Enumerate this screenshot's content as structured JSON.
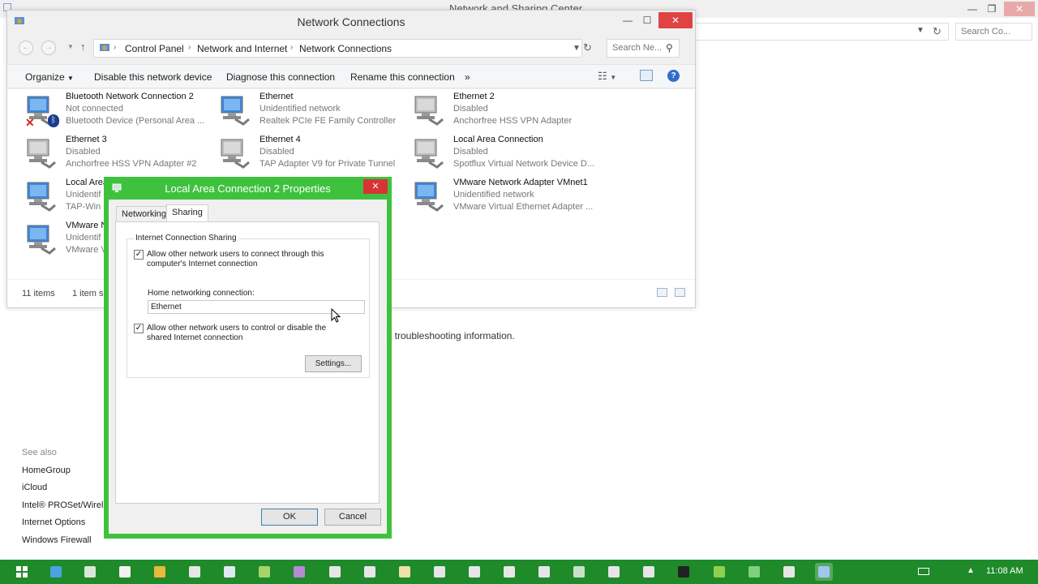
{
  "background_window": {
    "title": "Network and Sharing Center",
    "search_placeholder": "Search Co...",
    "info_text": "t troubleshooting information.",
    "see_also": {
      "heading": "See also",
      "links": [
        "HomeGroup",
        "iCloud",
        "Intel® PROSet/Wirel",
        "Internet Options",
        "Windows Firewall"
      ]
    }
  },
  "nc_window": {
    "title": "Network Connections",
    "breadcrumbs": [
      "Control Panel",
      "Network and Internet",
      "Network Connections"
    ],
    "search_placeholder": "Search Ne...",
    "toolbar": {
      "organize": "Organize",
      "disable": "Disable this network device",
      "diagnose": "Diagnose this connection",
      "rename": "Rename this connection",
      "more": "»"
    },
    "connections": [
      {
        "name": "Bluetooth Network Connection 2",
        "status": "Not connected",
        "device": "Bluetooth Device (Personal Area ..."
      },
      {
        "name": "Ethernet",
        "status": "Unidentified network",
        "device": "Realtek PCIe FE Family Controller"
      },
      {
        "name": "Ethernet 2",
        "status": "Disabled",
        "device": "Anchorfree HSS VPN Adapter"
      },
      {
        "name": "Ethernet 3",
        "status": "Disabled",
        "device": "Anchorfree HSS VPN Adapter #2"
      },
      {
        "name": "Ethernet 4",
        "status": "Disabled",
        "device": "TAP Adapter V9 for Private Tunnel"
      },
      {
        "name": "Local Area Connection",
        "status": "Disabled",
        "device": "Spotflux Virtual Network Device D..."
      },
      {
        "name": "Local Area",
        "status": "Unidentif",
        "device": "TAP-Win"
      },
      {
        "name": "VMware Network Adapter VMnet1",
        "status": "Unidentified network",
        "device": "VMware Virtual Ethernet Adapter ..."
      },
      {
        "name": "VMware N",
        "status": "Unidentif",
        "device": "VMware V"
      }
    ],
    "status_bar": {
      "items": "11 items",
      "selected": "1 item s"
    }
  },
  "dialog": {
    "title": "Local Area Connection 2 Properties",
    "tabs": [
      "Networking",
      "Sharing"
    ],
    "group_title": "Internet Connection Sharing",
    "allow_connect": "Allow other network users to connect through this computer's Internet connection",
    "home_label": "Home networking connection:",
    "home_value": "Ethernet",
    "allow_control": "Allow other network users to control or disable the shared Internet connection",
    "settings": "Settings...",
    "ok": "OK",
    "cancel": "Cancel"
  },
  "taskbar": {
    "clock": "11:08 AM"
  },
  "colors": {
    "dialog_frame": "#3ec23e",
    "taskbar": "#1e8a2a",
    "close_red": "#e04343"
  }
}
